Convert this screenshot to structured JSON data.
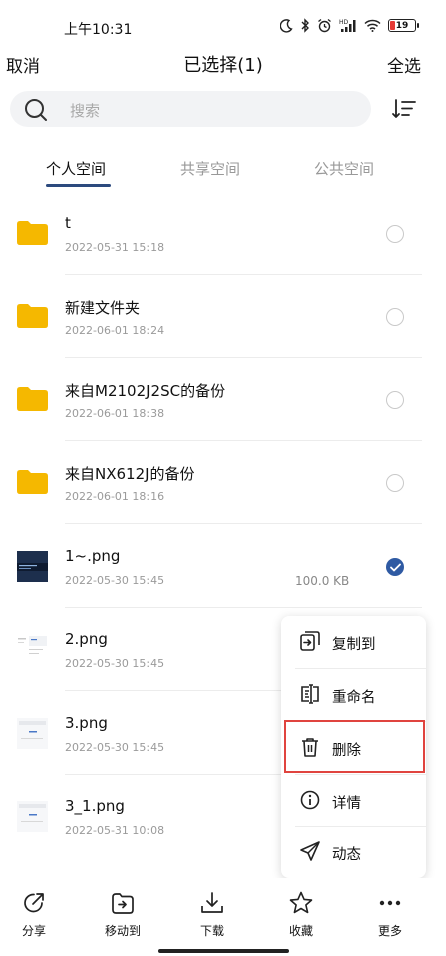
{
  "status_bar": {
    "time": "上午10:31",
    "battery": "19",
    "battery_level": 0.19
  },
  "nav": {
    "cancel": "取消",
    "title": "已选择(1)",
    "select_all": "全选"
  },
  "search": {
    "placeholder": "搜索"
  },
  "tabs": [
    {
      "label": "个人空间",
      "active": true
    },
    {
      "label": "共享空间",
      "active": false
    },
    {
      "label": "公共空间",
      "active": false
    }
  ],
  "files": [
    {
      "name": "t",
      "date": "2022-05-31 15:18",
      "size": "",
      "type": "folder",
      "checked": false
    },
    {
      "name": "新建文件夹",
      "date": "2022-06-01 18:24",
      "size": "",
      "type": "folder",
      "checked": false
    },
    {
      "name": "来自M2102J2SC的备份",
      "date": "2022-06-01 18:38",
      "size": "",
      "type": "folder",
      "checked": false
    },
    {
      "name": "来自NX612J的备份",
      "date": "2022-06-01 18:16",
      "size": "",
      "type": "folder",
      "checked": false
    },
    {
      "name": "1~.png",
      "date": "2022-05-30 15:45",
      "size": "100.0 KB",
      "type": "image",
      "checked": true
    },
    {
      "name": "2.png",
      "date": "2022-05-30 15:45",
      "size": "",
      "type": "image",
      "checked": false
    },
    {
      "name": "3.png",
      "date": "2022-05-30 15:45",
      "size": "",
      "type": "image",
      "checked": false
    },
    {
      "name": "3_1.png",
      "date": "2022-05-31 10:08",
      "size": "",
      "type": "image",
      "checked": false
    }
  ],
  "context_menu": {
    "items": [
      {
        "label": "复制到",
        "icon": "copy-to-icon"
      },
      {
        "label": "重命名",
        "icon": "rename-icon"
      },
      {
        "label": "删除",
        "icon": "trash-icon"
      },
      {
        "label": "详情",
        "icon": "info-icon"
      },
      {
        "label": "动态",
        "icon": "send-icon"
      }
    ]
  },
  "toolbar": {
    "items": [
      {
        "label": "分享",
        "icon": "share-icon"
      },
      {
        "label": "移动到",
        "icon": "move-icon"
      },
      {
        "label": "下载",
        "icon": "download-icon"
      },
      {
        "label": "收藏",
        "icon": "star-icon"
      },
      {
        "label": "更多",
        "icon": "more-icon"
      }
    ]
  },
  "colors": {
    "accent": "#2f5aa3",
    "folder": "#f5b800",
    "highlight": "#e0443f",
    "battery_low": "#e53935"
  }
}
